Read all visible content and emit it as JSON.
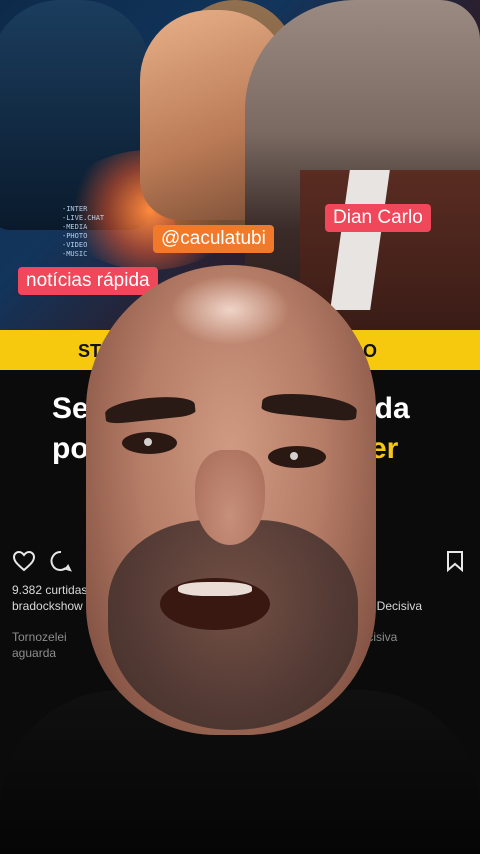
{
  "overlay_labels": {
    "dian": "Dian Carlo",
    "cacula": "@caculatubi",
    "noticias": "notícias rápida"
  },
  "code_lines": "-INTER\n-LIVE.CHAT\n-MEDIA\n-PHOTO\n-VIDEO\n-MUSIC",
  "band": {
    "left": "STF",
    "right": "IDO",
    "color": "#f6c90e"
  },
  "headline": {
    "line1_left": "Se",
    "line1_right": "ada",
    "line2_left": "po",
    "line2_right": "ter"
  },
  "post": {
    "likes": "9.382 curtidas",
    "author": "bradockshow Se",
    "caption_right": "Prova Decisiva",
    "sub_left": "Tornozelei",
    "sub_left2": "aguarda",
    "sub_right": "decisiva"
  },
  "icons": [
    "heart-icon",
    "comment-icon",
    "bookmark-icon"
  ],
  "colors": {
    "label_red": "#f0475a",
    "label_orange": "#f07a2a",
    "accent_yellow": "#f6c90e"
  }
}
